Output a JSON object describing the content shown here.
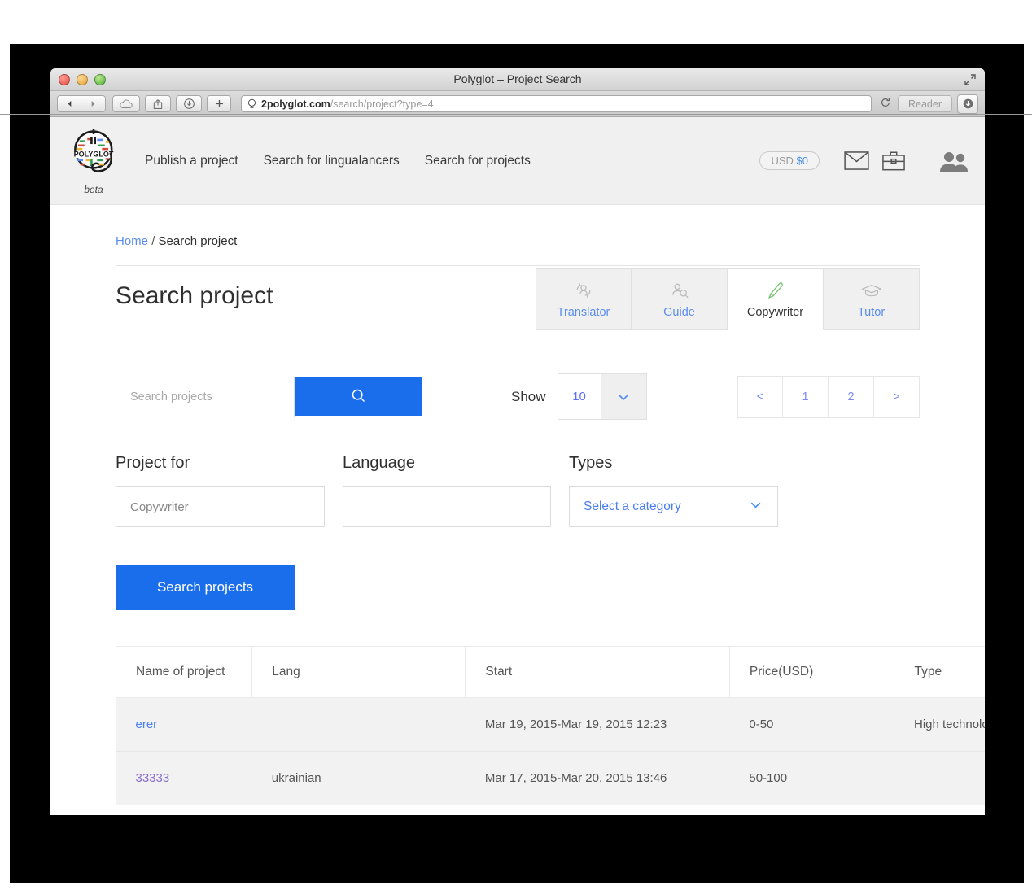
{
  "window": {
    "title": "Polyglot – Project Search",
    "url_domain": "2polyglot.com",
    "url_path": "/search/project?type=4",
    "reader_label": "Reader"
  },
  "header": {
    "logo_text": "POLYGLOT",
    "beta_label": "beta",
    "nav": [
      {
        "label": "Publish a project"
      },
      {
        "label": "Search for lingualancers"
      },
      {
        "label": "Search for projects"
      }
    ],
    "balance_currency": "USD",
    "balance_amount": "$0"
  },
  "breadcrumb": {
    "home": "Home",
    "separator": "/",
    "current": "Search project"
  },
  "main": {
    "page_title": "Search project",
    "category_tabs": [
      {
        "label": "Translator",
        "icon": "translate-person-icon",
        "active": false
      },
      {
        "label": "Guide",
        "icon": "person-search-icon",
        "active": false
      },
      {
        "label": "Copywriter",
        "icon": "pen-icon",
        "active": true
      },
      {
        "label": "Tutor",
        "icon": "graduation-cap-icon",
        "active": false
      }
    ],
    "search": {
      "placeholder": "Search projects",
      "value": ""
    },
    "show": {
      "label": "Show",
      "value": "10"
    },
    "pagination": {
      "prev": "<",
      "pages": [
        "1",
        "2"
      ],
      "next": ">"
    },
    "filters": [
      {
        "label": "Project for",
        "placeholder": "Copywriter",
        "value": ""
      },
      {
        "label": "Language",
        "placeholder": "",
        "value": ""
      }
    ],
    "types_filter": {
      "label": "Types",
      "selected": "Select a category"
    },
    "submit_label": "Search projects"
  },
  "table": {
    "columns": [
      "Name of project",
      "Lang",
      "Start",
      "Price(USD)",
      "Type"
    ],
    "rows": [
      {
        "name": "erer",
        "lang": "",
        "start": "Mar 19, 2015-Mar 19, 2015 12:23",
        "price": "0-50",
        "type": "High technology"
      },
      {
        "name": "33333",
        "lang": "ukrainian",
        "start": "Mar 17, 2015-Mar 20, 2015 13:46",
        "price": "50-100",
        "type": ""
      }
    ]
  },
  "colors": {
    "accent_blue": "#1a6eeb",
    "link_blue": "#4a7df0",
    "visited_purple": "#8a6fc9",
    "pen_green": "#7cc576"
  }
}
